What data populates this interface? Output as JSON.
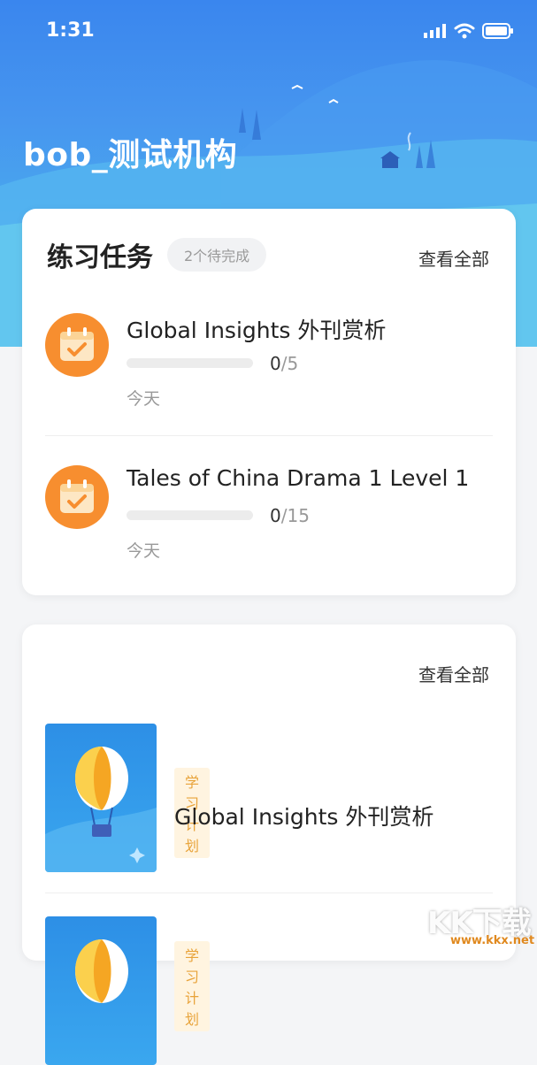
{
  "status_bar": {
    "time": "1:31",
    "icons": [
      "signal-icon",
      "wifi-icon",
      "battery-icon"
    ]
  },
  "org": {
    "title": "bob_测试机构"
  },
  "tasks_card": {
    "title": "练习任务",
    "pending_badge": "2个待完成",
    "view_all": "查看全部",
    "items": [
      {
        "name": "Global Insights 外刊赏析",
        "done": "0",
        "total": "/5",
        "progress": 0,
        "date": "今天",
        "icon": "calendar-check-icon"
      },
      {
        "name": "Tales of China Drama 1 Level 1",
        "done": "0",
        "total": "/15",
        "progress": 0,
        "date": "今天",
        "icon": "calendar-check-icon"
      }
    ]
  },
  "plans_card": {
    "view_all": "查看全部",
    "items": [
      {
        "tag": "学习计划",
        "name": "Global Insights 外刊赏析",
        "cover_icon": "hot-air-balloon-icon"
      },
      {
        "tag": "学习计划",
        "name": "",
        "cover_icon": "hot-air-balloon-icon"
      }
    ]
  },
  "watermark": {
    "text": "KK下载",
    "url": "www.kkx.net"
  },
  "colors": {
    "header_blue": "#3a86ee",
    "task_icon_orange": "#f78e2f",
    "tag_text": "#e8a33a",
    "tag_bg": "#fff4e0"
  }
}
